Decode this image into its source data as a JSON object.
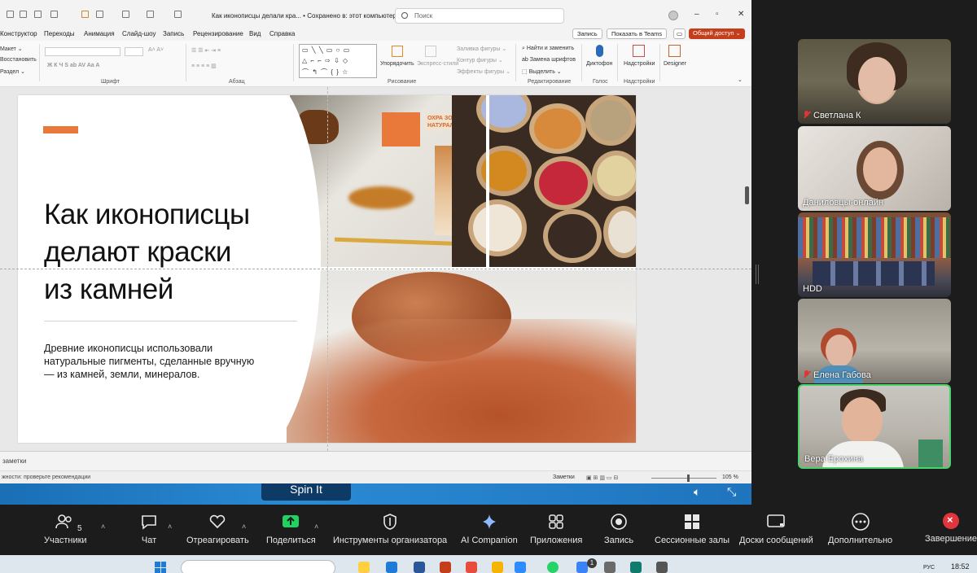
{
  "ppt": {
    "doc_title": "Как иконописцы делали кра... • Сохранено в: этот компьютер ⌄",
    "search_placeholder": "Поиск",
    "menu": [
      "Конструктор",
      "Переходы",
      "Анимация",
      "Слайд-шоу",
      "Запись",
      "Рецензирование",
      "Вид",
      "Справка"
    ],
    "record_btn": "Запись",
    "teams_btn": "Показать в Teams",
    "share_btn": "Общий доступ ⌄",
    "ribbon": {
      "slide_left": [
        "Макет ⌄",
        "Восстановить",
        "Раздел ⌄"
      ],
      "group_font": "Шрифт",
      "group_paragraph": "Абзац",
      "group_drawing": "Рисование",
      "group_editing": "Редактирование",
      "group_voice": "Голос",
      "group_addins": "Надстройки",
      "arrange": "Упорядочить",
      "express_styles": "Экспресс-стили",
      "shape_fill": "Заливка фигуры ⌄",
      "shape_outline": "Контур фигуры ⌄",
      "shape_effects": "Эффекты фигуры ⌄",
      "find_replace": "Найти и заменить",
      "replace_fonts": "Замена шрифтов",
      "select": "Выделить ⌄",
      "dictaphone": "Диктофон",
      "addins": "Надстройки",
      "designer": "Designer"
    },
    "slide": {
      "title": "Как иконописцы\nделают краски\nиз камней",
      "body": "Древние иконописцы использовали\nнатуральные пигменты, сделанные вручную\n— из камней, земли, минералов.",
      "photo_label": "ОХРА ЗОЛ\nНАТУРАЛЬНЫЙ П"
    },
    "notes_label": "заметки",
    "status_text": "жности: проверьте рекомендации",
    "status_notes": "Заметки",
    "zoom": "105 %"
  },
  "spin_it": "Spin It",
  "participants": [
    {
      "name": "Светлана К",
      "muted": true
    },
    {
      "name": "Даниловцы-онлайн",
      "muted": false
    },
    {
      "name": "HDD",
      "muted": false
    },
    {
      "name": "Елена Габова",
      "muted": true
    },
    {
      "name": "Вера Ерохина",
      "muted": false
    }
  ],
  "toolbar": {
    "participants_label": "Участники",
    "participants_count": "5",
    "chat": "Чат",
    "react": "Отреагировать",
    "share": "Поделиться",
    "host_tools": "Инструменты организатора",
    "ai_companion": "AI Companion",
    "apps": "Приложения",
    "record": "Запись",
    "breakout": "Сессионные залы",
    "whiteboards": "Доски сообщений",
    "more": "Дополнительно",
    "end": "Завершение"
  },
  "taskbar": {
    "clock": "18:52",
    "lang": "РУС",
    "badge": "1"
  },
  "colors": {
    "accent_orange": "#e8793b",
    "share_red": "#c43e1c",
    "active_speaker": "#4ad26b",
    "zoom_share_green": "#23d160",
    "end_red": "#e0353d"
  }
}
